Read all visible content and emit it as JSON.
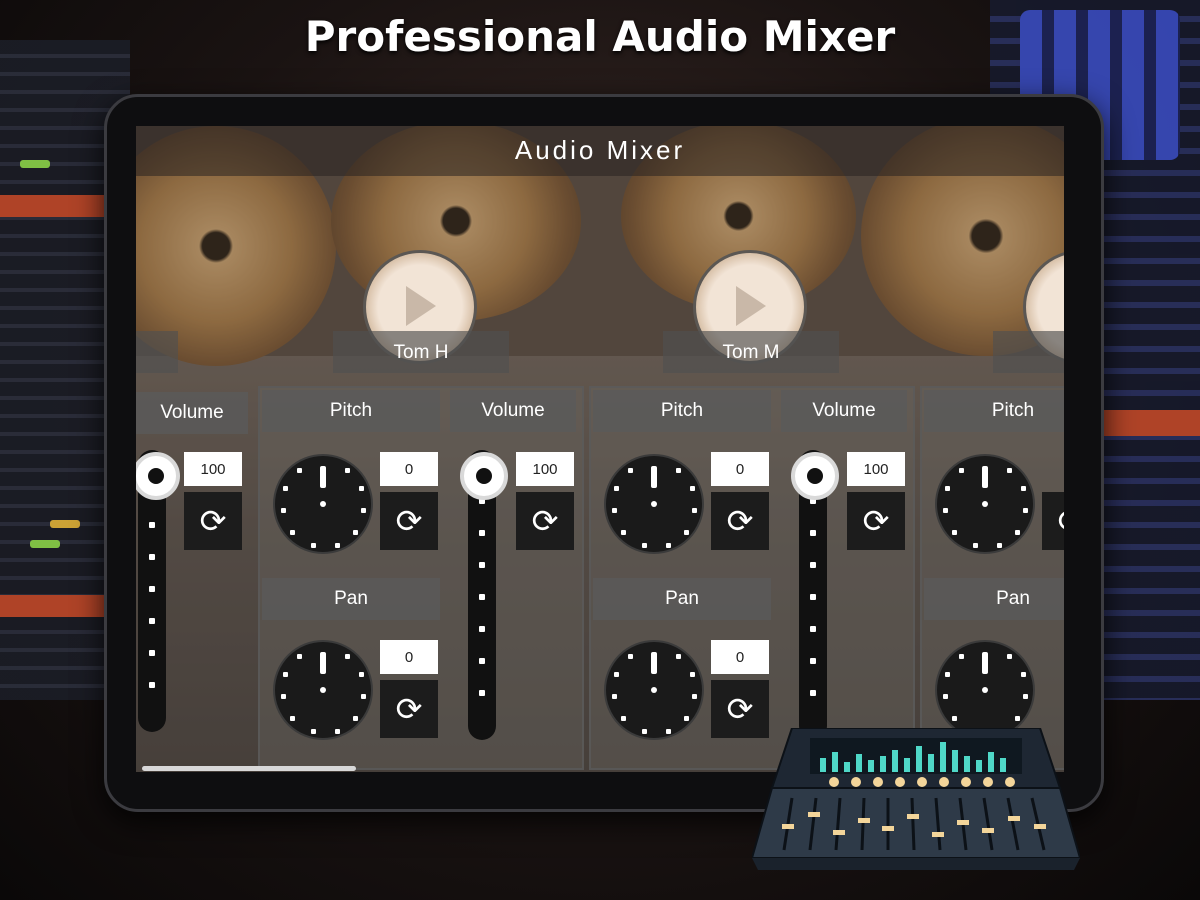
{
  "headline": "Professional Audio Mixer",
  "app": {
    "title": "Audio Mixer"
  },
  "channels": [
    {
      "name": "Tom H",
      "volume_label": "Volume",
      "volume_value": "100",
      "pitch_label": "Pitch",
      "pitch_value": "0",
      "pan_label": "Pan",
      "pan_value": "0"
    },
    {
      "name": "Tom M",
      "volume_label": "Volume",
      "volume_value": "100",
      "pitch_label": "Pitch",
      "pitch_value": "0",
      "pan_label": "Pan",
      "pan_value": "0"
    }
  ],
  "partial_left": {
    "volume_label": "Volume",
    "volume_value": "100"
  },
  "partial_right": {
    "name": "T",
    "pitch_label": "Pitch",
    "pan_label": "Pan"
  },
  "icons": {
    "play": "play-icon",
    "reset": "refresh-icon",
    "mixer": "mixer-console-icon"
  },
  "colors": {
    "accent": "#c0492a",
    "panel": "#5a5a5a",
    "knob": "#1a1a1a"
  }
}
